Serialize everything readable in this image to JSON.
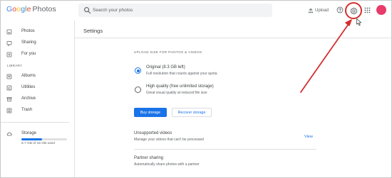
{
  "header": {
    "logo_word_1": "Google",
    "logo_word_2": "Photos",
    "search_placeholder": "Search your photos",
    "upload_label": "Upload"
  },
  "sidebar": {
    "items": [
      {
        "label": "Photos",
        "icon": "photo-icon"
      },
      {
        "label": "Sharing",
        "icon": "sharing-icon"
      },
      {
        "label": "For you",
        "icon": "for-you-icon"
      }
    ],
    "library_label": "LIBRARY",
    "library_items": [
      {
        "label": "Albums",
        "icon": "albums-icon"
      },
      {
        "label": "Utilities",
        "icon": "utilities-icon"
      },
      {
        "label": "Archive",
        "icon": "archive-icon"
      },
      {
        "label": "Trash",
        "icon": "trash-icon"
      }
    ],
    "storage": {
      "label": "Storage",
      "used_text": "6.7 GB of 15 GB used",
      "used_fraction": 0.45
    }
  },
  "main": {
    "title": "Settings",
    "upload_size_heading": "UPLOAD SIZE FOR PHOTOS & VIDEOS",
    "options": [
      {
        "title": "Original (8.3 GB left)",
        "desc": "Full resolution that counts against your quota",
        "selected": true
      },
      {
        "title": "High quality (free unlimited storage)",
        "desc": "Great visual quality at reduced file size",
        "selected": false
      }
    ],
    "buy_storage_label": "Buy storage",
    "recover_storage_label": "Recover storage",
    "unsupported": {
      "title": "Unsupported videos",
      "desc": "Manage your videos that can't be processed",
      "action": "View"
    },
    "partner": {
      "title": "Partner sharing",
      "desc": "Automatically share photos with a partner"
    }
  },
  "colors": {
    "accent": "#1a73e8",
    "annotation": "#d32f2f",
    "avatar": "#e83b6a"
  }
}
